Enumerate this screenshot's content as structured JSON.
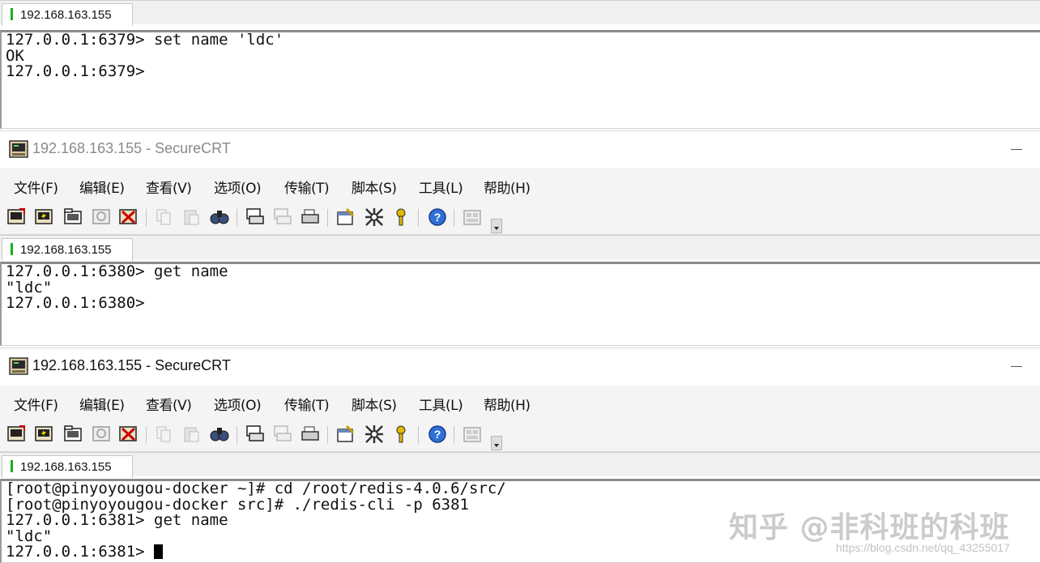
{
  "session_tab": "192.168.163.155",
  "window_title": "192.168.163.155 - SecureCRT",
  "menu": [
    "文件(F)",
    "编辑(E)",
    "查看(V)",
    "选项(O)",
    "传输(T)",
    "脚本(S)",
    "工具(L)",
    "帮助(H)"
  ],
  "toolbar_icons": [
    "connect-icon",
    "quick-connect-icon",
    "connect-in-tab-icon",
    "reconnect-icon",
    "disconnect-icon",
    "copy-icon",
    "paste-icon",
    "find-icon",
    "print-screen-icon",
    "print-selection-icon",
    "print-icon",
    "session-options-icon",
    "global-options-icon",
    "keymap-icon",
    "help-icon",
    "tile-windows-icon"
  ],
  "terminals": [
    {
      "lines": [
        "127.0.0.1:6379> set name 'ldc'",
        "OK",
        "127.0.0.1:6379>"
      ]
    },
    {
      "lines": [
        "127.0.0.1:6380> get name",
        "\"ldc\"",
        "127.0.0.1:6380>"
      ]
    },
    {
      "lines": [
        "[root@pinyoyougou-docker ~]# cd /root/redis-4.0.6/src/",
        "[root@pinyoyougou-docker src]# ./redis-cli -p 6381",
        "127.0.0.1:6381> get name",
        "\"ldc\"",
        "127.0.0.1:6381> "
      ]
    }
  ],
  "watermark": "知乎 @非科班的科班",
  "watermark_url": "https://blog.csdn.net/qq_43255017"
}
